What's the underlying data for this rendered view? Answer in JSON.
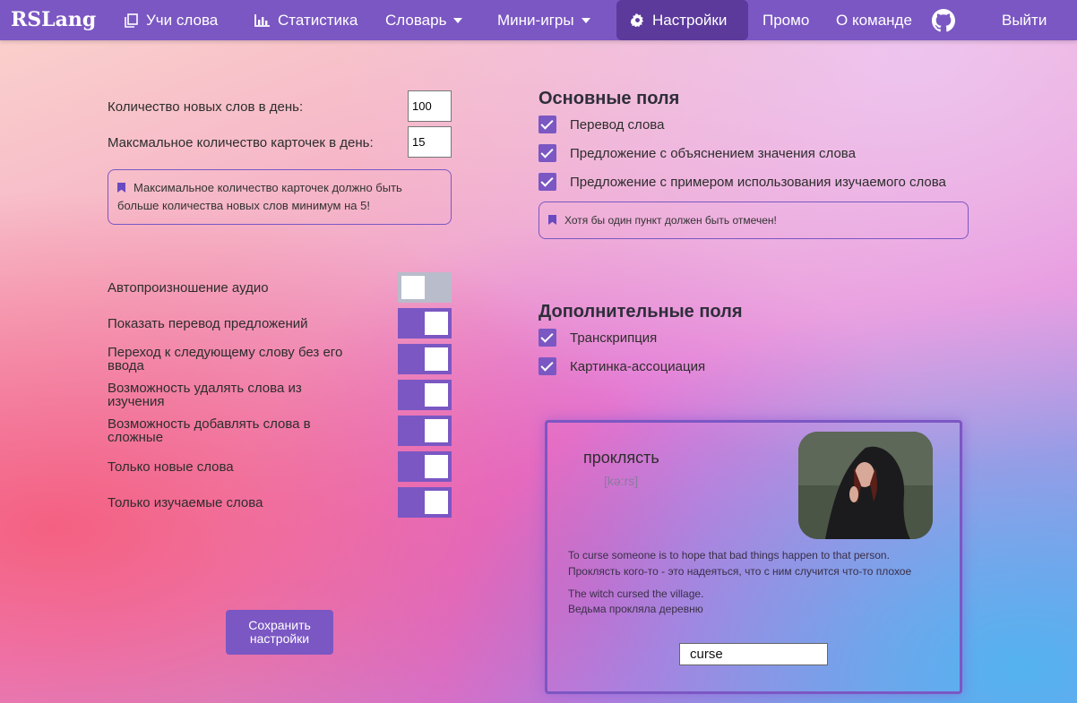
{
  "nav": {
    "logo": "RSLang",
    "learn": "Учи слова",
    "stats": "Статистика",
    "dictionary": "Словарь",
    "minigames": "Мини-игры",
    "settings": "Настройки",
    "promo": "Промо",
    "team": "О команде",
    "logout": "Выйти"
  },
  "left": {
    "new_words_label": "Количество новых слов в день:",
    "new_words_value": "100",
    "max_cards_label": "Максмальное количество карточек в день:",
    "max_cards_value": "15",
    "note": "Максимальное количество карточек должно быть больше количества новых слов минимум на 5!",
    "toggles": [
      {
        "label": "Автопроизношение аудио",
        "on": false
      },
      {
        "label": "Показать перевод предложений",
        "on": true
      },
      {
        "label": "Переход к следующему слову без его ввода",
        "on": true
      },
      {
        "label": "Возможность удалять слова из изучения",
        "on": true
      },
      {
        "label": "Возможность добавлять слова в сложные",
        "on": true
      },
      {
        "label": "Только новые слова",
        "on": true
      },
      {
        "label": "Только изучаемые слова",
        "on": true
      }
    ],
    "save_button": "Сохранить настройки"
  },
  "right": {
    "main_title": "Основные поля",
    "main_fields": [
      "Перевод слова",
      "Предложение с объяснением значения слова",
      "Предложение с примером использования изучаемого слова"
    ],
    "main_note": "Хотя бы один пункт должен быть отмечен!",
    "extra_title": "Дополнительные поля",
    "extra_fields": [
      "Транскрипция",
      "Картинка-ассоциация"
    ]
  },
  "card": {
    "word": "проклясть",
    "transcription": "[kə:rs]",
    "meaning_en": "To curse someone is to hope that bad things happen to that person.",
    "meaning_ru": "Проклясть кого-то - это надеяться, что с ним случится что-то плохое",
    "example_en": "The witch cursed the village.",
    "example_ru": "Ведьма прокляла деревню",
    "answer": "curse"
  },
  "colors": {
    "accent": "#7b57c3",
    "accent_dark": "#5b3a9b",
    "toggle_off": "#b9bccb"
  }
}
